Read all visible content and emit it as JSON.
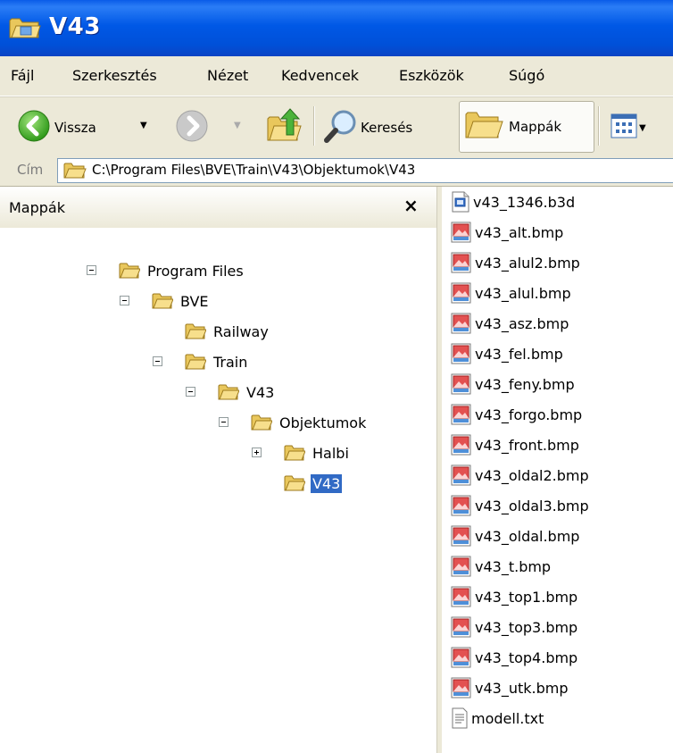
{
  "window": {
    "title": "V43"
  },
  "menu": {
    "items": [
      "Fájl",
      "Szerkesztés",
      "Nézet",
      "Kedvencek",
      "Eszközök",
      "Súgó"
    ]
  },
  "toolbar": {
    "back_label": "Vissza",
    "search_label": "Keresés",
    "folders_label": "Mappák"
  },
  "address": {
    "label": "Cím",
    "path": "C:\\Program Files\\BVE\\Train\\V43\\Objektumok\\V43"
  },
  "folders_pane": {
    "title": "Mappák",
    "close_symbol": "×",
    "tree": [
      {
        "label": "Program Files",
        "depth": 0,
        "expander": "minus",
        "selected": false
      },
      {
        "label": "BVE",
        "depth": 1,
        "expander": "minus",
        "selected": false
      },
      {
        "label": "Railway",
        "depth": 2,
        "expander": "none",
        "selected": false
      },
      {
        "label": "Train",
        "depth": 2,
        "expander": "minus",
        "selected": false
      },
      {
        "label": "V43",
        "depth": 3,
        "expander": "minus",
        "selected": false
      },
      {
        "label": "Objektumok",
        "depth": 4,
        "expander": "minus",
        "selected": false
      },
      {
        "label": "Halbi",
        "depth": 5,
        "expander": "plus",
        "selected": false
      },
      {
        "label": "V43",
        "depth": 5,
        "expander": "none",
        "selected": true
      }
    ]
  },
  "files": [
    {
      "name": "v43_1346.b3d",
      "type": "b3d"
    },
    {
      "name": "v43_alt.bmp",
      "type": "bmp"
    },
    {
      "name": "v43_alul2.bmp",
      "type": "bmp"
    },
    {
      "name": "v43_alul.bmp",
      "type": "bmp"
    },
    {
      "name": "v43_asz.bmp",
      "type": "bmp"
    },
    {
      "name": "v43_fel.bmp",
      "type": "bmp"
    },
    {
      "name": "v43_feny.bmp",
      "type": "bmp"
    },
    {
      "name": "v43_forgo.bmp",
      "type": "bmp"
    },
    {
      "name": "v43_front.bmp",
      "type": "bmp"
    },
    {
      "name": "v43_oldal2.bmp",
      "type": "bmp"
    },
    {
      "name": "v43_oldal3.bmp",
      "type": "bmp"
    },
    {
      "name": "v43_oldal.bmp",
      "type": "bmp"
    },
    {
      "name": "v43_t.bmp",
      "type": "bmp"
    },
    {
      "name": "v43_top1.bmp",
      "type": "bmp"
    },
    {
      "name": "v43_top3.bmp",
      "type": "bmp"
    },
    {
      "name": "v43_top4.bmp",
      "type": "bmp"
    },
    {
      "name": "v43_utk.bmp",
      "type": "bmp"
    },
    {
      "name": "modell.txt",
      "type": "txt"
    }
  ],
  "icons": {
    "folder": "folder-icon",
    "bmp": "bitmap-file-icon",
    "b3d": "generic-file-icon",
    "txt": "text-file-icon"
  },
  "colors": {
    "titlebar": "#0054e3",
    "chrome": "#ece9d8",
    "selection": "#316ac5"
  }
}
